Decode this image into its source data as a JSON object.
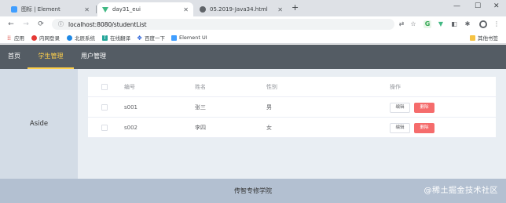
{
  "browser": {
    "tabs": [
      {
        "title": "图标 | Element",
        "favicon": "element-favicon",
        "active": false
      },
      {
        "title": "day31_eui",
        "favicon": "vue-favicon",
        "active": true
      },
      {
        "title": "05.2019-Java34.html",
        "favicon": "globe-favicon",
        "active": false
      }
    ],
    "new_tab_label": "+",
    "url": "localhost:8080/studentList",
    "bookmarks": [
      {
        "label": "应用",
        "icon": "apps-grid-icon"
      },
      {
        "label": "内网登录",
        "icon": "red-dot-icon"
      },
      {
        "label": "北辰系统",
        "icon": "blue-dot-icon"
      },
      {
        "label": "在线翻译",
        "icon": "translate-icon"
      },
      {
        "label": "百度一下",
        "icon": "baidu-paw-icon"
      },
      {
        "label": "Element UI",
        "icon": "element-icon"
      }
    ],
    "other_bookmarks": "其他书签"
  },
  "app": {
    "menu": [
      {
        "label": "首页",
        "active": false
      },
      {
        "label": "学生管理",
        "active": true
      },
      {
        "label": "用户管理",
        "active": false
      }
    ],
    "aside_label": "Aside",
    "table": {
      "headers": {
        "id": "编号",
        "name": "姓名",
        "gender": "性别",
        "actions": "操作"
      },
      "rows": [
        {
          "id": "s001",
          "name": "张三",
          "gender": "男"
        },
        {
          "id": "s002",
          "name": "李四",
          "gender": "女"
        }
      ],
      "edit_label": "编辑",
      "delete_label": "删除"
    },
    "footer_text": "传智专修学院",
    "watermark": "@稀土掘金技术社区"
  },
  "colors": {
    "header_bg": "#545c64",
    "menu_active": "#ffd04b",
    "aside_bg": "#d3dce6",
    "main_bg": "#e9eef3",
    "footer_bg": "#b3c0d1",
    "danger": "#f56c6c"
  }
}
